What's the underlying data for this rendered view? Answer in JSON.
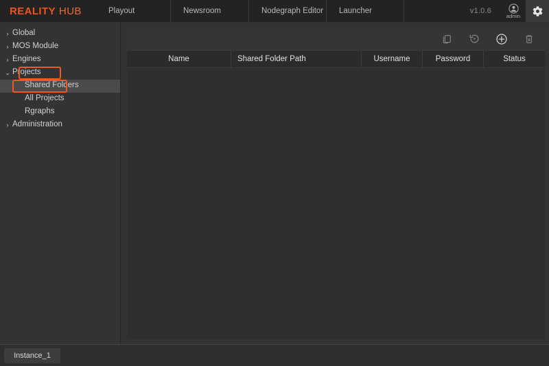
{
  "header": {
    "brand_primary": "REALITY",
    "brand_secondary": "HUB",
    "version": "v1.0.6",
    "user_label": "admin",
    "tabs": [
      {
        "label": "Playout"
      },
      {
        "label": "Newsroom"
      },
      {
        "label": "Nodegraph Editor"
      },
      {
        "label": "Launcher"
      }
    ],
    "settings_icon": "gear-icon",
    "user_icon": "user-avatar-icon"
  },
  "sidebar": {
    "items": [
      {
        "label": "Global",
        "expanded": false,
        "child": false,
        "selected": false,
        "annotated": false
      },
      {
        "label": "MOS Module",
        "expanded": false,
        "child": false,
        "selected": false,
        "annotated": false
      },
      {
        "label": "Engines",
        "expanded": false,
        "child": false,
        "selected": false,
        "annotated": false
      },
      {
        "label": "Projects",
        "expanded": true,
        "child": false,
        "selected": false,
        "annotated": true
      },
      {
        "label": "Shared Folders",
        "expanded": false,
        "child": true,
        "selected": true,
        "annotated": true
      },
      {
        "label": "All Projects",
        "expanded": false,
        "child": true,
        "selected": false,
        "annotated": false
      },
      {
        "label": "Rgraphs",
        "expanded": false,
        "child": true,
        "selected": false,
        "annotated": false
      },
      {
        "label": "Administration",
        "expanded": false,
        "child": false,
        "selected": false,
        "annotated": false
      }
    ],
    "chevron_collapsed": "›",
    "chevron_expanded": "⌄"
  },
  "toolbar": {
    "buttons": [
      {
        "name": "duplicate-icon",
        "title": "Duplicate",
        "active": false
      },
      {
        "name": "revert-icon",
        "title": "Revert",
        "active": false
      },
      {
        "name": "add-icon",
        "title": "Add",
        "active": true
      },
      {
        "name": "delete-icon",
        "title": "Delete",
        "active": false
      }
    ]
  },
  "table": {
    "columns": [
      {
        "label": "Name",
        "key": "name"
      },
      {
        "label": "Shared Folder Path",
        "key": "path"
      },
      {
        "label": "Username",
        "key": "username"
      },
      {
        "label": "Password",
        "key": "password"
      },
      {
        "label": "Status",
        "key": "status"
      }
    ],
    "rows": []
  },
  "footer": {
    "instance_label": "Instance_1"
  },
  "colors": {
    "brand_orange": "#f0541e",
    "annotation_orange": "#f05a22",
    "topbar_bg": "#232323",
    "app_bg": "#333333",
    "panel_bg": "#2f2f2f",
    "header_row_bg": "#2b2b2b",
    "selected_row_bg": "#4a4a4a"
  }
}
